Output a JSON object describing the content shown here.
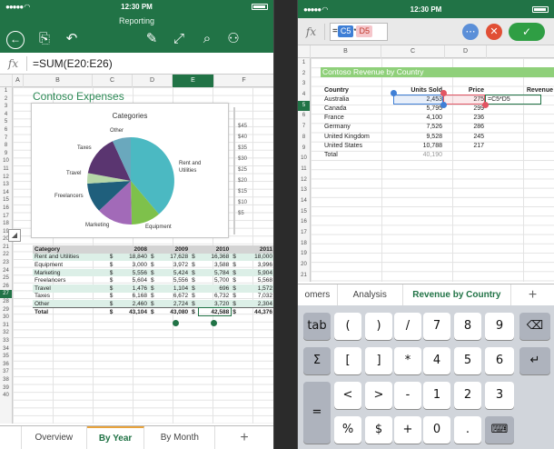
{
  "left": {
    "status": {
      "time": "12:30 PM"
    },
    "app_title": "Reporting",
    "toolbar": {
      "icons": [
        "back-icon",
        "file-icon",
        "undo-icon",
        "draw-icon",
        "expand-icon",
        "search-icon",
        "add-person-icon"
      ]
    },
    "formula": {
      "label": "fx",
      "text": "=SUM(E20:E26)"
    },
    "columns": [
      "A",
      "B",
      "C",
      "D",
      "E",
      "F"
    ],
    "rows": [
      "1",
      "2",
      "3",
      "4",
      "5",
      "6",
      "7",
      "8",
      "9",
      "10",
      "11",
      "12",
      "13",
      "14",
      "15",
      "16",
      "17",
      "18",
      "19",
      "20",
      "21",
      "22",
      "23",
      "24",
      "25",
      "26",
      "27",
      "28",
      "29",
      "30",
      "31",
      "32",
      "33",
      "34",
      "35",
      "36",
      "37",
      "38",
      "39",
      "40"
    ],
    "sheet_title": "Contoso Expenses",
    "chart": {
      "title": "Categories",
      "labels": [
        "Other",
        "Taxes",
        "Travel",
        "Freelancers",
        "Marketing",
        "Equipment",
        "Rent and Utilities"
      ],
      "side_values": [
        "$45",
        "$40",
        "$35",
        "$30",
        "$25",
        "$20",
        "$15",
        "$10",
        "$5"
      ]
    },
    "table": {
      "headers": [
        "Category",
        "2008",
        "2009",
        "2010",
        "2011"
      ],
      "rows": [
        [
          "Rent and Utilities",
          "$",
          "18,840",
          "$",
          "17,628",
          "$",
          "16,368",
          "$",
          "18,000"
        ],
        [
          "Equipment",
          "$",
          "3,000",
          "$",
          "3,972",
          "$",
          "3,588",
          "$",
          "3,996"
        ],
        [
          "Marketing",
          "$",
          "5,556",
          "$",
          "5,424",
          "$",
          "5,784",
          "$",
          "5,904"
        ],
        [
          "Freelancers",
          "$",
          "5,604",
          "$",
          "5,556",
          "$",
          "5,700",
          "$",
          "5,568"
        ],
        [
          "Travel",
          "$",
          "1,476",
          "$",
          "1,104",
          "$",
          "696",
          "$",
          "1,572"
        ],
        [
          "Taxes",
          "$",
          "6,168",
          "$",
          "6,672",
          "$",
          "6,732",
          "$",
          "7,032"
        ],
        [
          "Other",
          "$",
          "2,460",
          "$",
          "2,724",
          "$",
          "3,720",
          "$",
          "2,304"
        ]
      ],
      "total": [
        "Total",
        "$",
        "43,104",
        "$",
        "43,080",
        "$",
        "42,588",
        "$",
        "44,376"
      ]
    },
    "tabs": {
      "overview": "Overview",
      "by_year": "By Year",
      "by_month": "By Month",
      "plus": "+"
    }
  },
  "right": {
    "status": {
      "time": "12:30 PM"
    },
    "formula": {
      "label": "fx",
      "eq": "=",
      "ref1": "C5",
      "op": "*",
      "ref2": "D5"
    },
    "columns": [
      "B",
      "C",
      "D"
    ],
    "rows": [
      "1",
      "2",
      "3",
      "4",
      "5",
      "6",
      "7",
      "8",
      "9",
      "10",
      "11",
      "12",
      "13",
      "14",
      "15",
      "16",
      "17",
      "18",
      "19",
      "20",
      "21"
    ],
    "sheet_title": "Contoso Revenue by Country",
    "table": {
      "headers": [
        "Country",
        "Units Sold",
        "Price",
        "Revenue"
      ],
      "rows": [
        [
          "Australia",
          "2,453",
          "275",
          "=C5*D5"
        ],
        [
          "Canada",
          "5,795",
          "299",
          ""
        ],
        [
          "France",
          "4,100",
          "236",
          ""
        ],
        [
          "Germany",
          "7,526",
          "286",
          ""
        ],
        [
          "United Kingdom",
          "9,528",
          "245",
          ""
        ],
        [
          "United States",
          "10,788",
          "217",
          ""
        ],
        [
          "Total",
          "40,190",
          "",
          ""
        ]
      ]
    },
    "tabs": {
      "t1": "omers",
      "t2": "Analysis",
      "t3": "Revenue by Country",
      "plus": "+"
    },
    "keyboard": {
      "row1": [
        "tab",
        "(",
        ")",
        "/",
        "7",
        "8",
        "9",
        "⌫"
      ],
      "row2": [
        "Σ",
        "[",
        "]",
        "*",
        "4",
        "5",
        "6",
        "↵"
      ],
      "row3": [
        "",
        "<",
        ">",
        "-",
        "1",
        "2",
        "3"
      ],
      "row4": [
        "=",
        "%",
        "$",
        "+",
        "0",
        ".",
        "⌨"
      ]
    }
  },
  "colors": {
    "excel_green": "#217346",
    "title_green": "#2e8b57",
    "band": "#dcefe7"
  }
}
